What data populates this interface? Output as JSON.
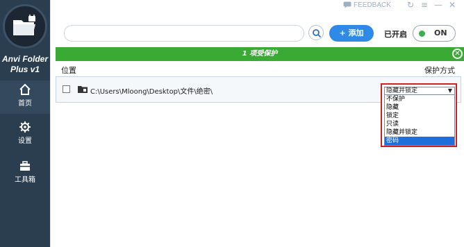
{
  "window": {
    "feedback_label": "FEEDBACK"
  },
  "sidebar": {
    "app_name_line1": "Anvi Folder",
    "app_name_line2": "Plus v1",
    "items": [
      {
        "label": "首页",
        "icon": "home-icon",
        "active": true
      },
      {
        "label": "设置",
        "icon": "gear-icon",
        "active": false
      },
      {
        "label": "工具箱",
        "icon": "toolbox-icon",
        "active": false
      }
    ]
  },
  "toolbar": {
    "search_placeholder": "",
    "add_label": "+ 添加",
    "status_label": "已开启",
    "toggle_label": "ON"
  },
  "banner": {
    "text": "1 项受保护"
  },
  "table": {
    "col_location": "位置",
    "col_mode": "保护方式",
    "rows": [
      {
        "path": "C:\\Users\\Mloong\\Desktop\\文件\\绝密\\",
        "mode": "隐藏并锁定"
      }
    ]
  },
  "dropdown": {
    "selected": "隐藏并锁定",
    "options": [
      "不保护",
      "隐藏",
      "锁定",
      "只读",
      "隐藏并锁定",
      "密码"
    ],
    "highlighted_index": 5
  },
  "colors": {
    "sidebar_bg": "#2b3e50",
    "accent_blue": "#2e8ae6",
    "banner_green": "#3aaa35",
    "highlight_red": "#d21f1f"
  }
}
